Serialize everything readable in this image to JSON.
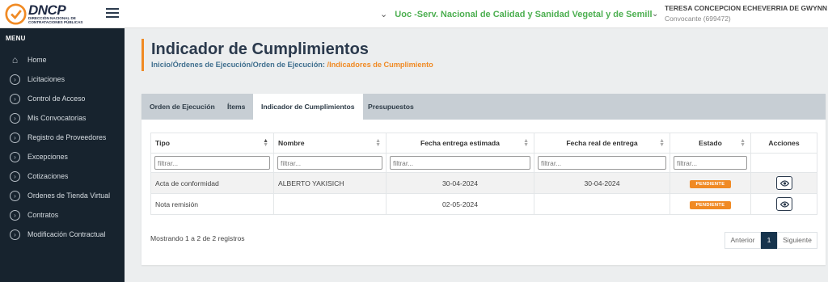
{
  "brand": {
    "name": "DNCP",
    "subtitle": "Dirección Nacional de Contrataciones Públicas"
  },
  "header": {
    "entity": "Uoc -Serv. Nacional de Calidad y Sanidad Vegetal y de Semill",
    "user_name": "TERESA CONCEPCION ECHEVERRIA DE GWYNN",
    "user_role": "Convocante (699472)"
  },
  "sidebar": {
    "title": "MENU",
    "items": [
      {
        "label": "Home",
        "icon": "home-icon"
      },
      {
        "label": "Licitaciones",
        "icon": "chevron-circle-icon"
      },
      {
        "label": "Control de Acceso",
        "icon": "chevron-circle-icon"
      },
      {
        "label": "Mis Convocatorias",
        "icon": "chevron-circle-icon"
      },
      {
        "label": "Registro de Proveedores",
        "icon": "chevron-circle-icon"
      },
      {
        "label": "Excepciones",
        "icon": "chevron-circle-icon"
      },
      {
        "label": "Cotizaciones",
        "icon": "chevron-circle-icon"
      },
      {
        "label": "Ordenes de Tienda Virtual",
        "icon": "chevron-circle-icon"
      },
      {
        "label": "Contratos",
        "icon": "chevron-circle-icon"
      },
      {
        "label": "Modificación Contractual",
        "icon": "chevron-circle-icon"
      }
    ]
  },
  "page": {
    "title": "Indicador de Cumplimientos",
    "breadcrumb": [
      "Inicio",
      "Órdenes de Ejecución",
      "Orden de Ejecución:",
      "Indicadores de Cumplimiento"
    ]
  },
  "tabs": [
    "Orden de Ejecución",
    "Ítems",
    "Indicador de Cumplimientos",
    "Presupuestos"
  ],
  "table": {
    "columns": [
      "Tipo",
      "Nombre",
      "Fecha entrega estimada",
      "Fecha real de entrega",
      "Estado",
      "Acciones"
    ],
    "filter_placeholder": "filtrar...",
    "rows": [
      {
        "tipo": "Acta de conformidad",
        "nombre": "ALBERTO YAKISICH",
        "fecha_estimada": "30-04-2024",
        "fecha_real": "30-04-2024",
        "estado": "PENDIENTE"
      },
      {
        "tipo": "Nota remisión",
        "nombre": "",
        "fecha_estimada": "02-05-2024",
        "fecha_real": "",
        "estado": "PENDIENTE"
      }
    ]
  },
  "footer": {
    "info": "Mostrando 1 a 2 de 2 registros",
    "prev": "Anterior",
    "page": "1",
    "next": "Siguiente"
  },
  "colors": {
    "sidebar_bg": "#17232e",
    "accent_orange": "#f08a24",
    "entity_green": "#4caf50",
    "pager_active": "#17344d"
  }
}
